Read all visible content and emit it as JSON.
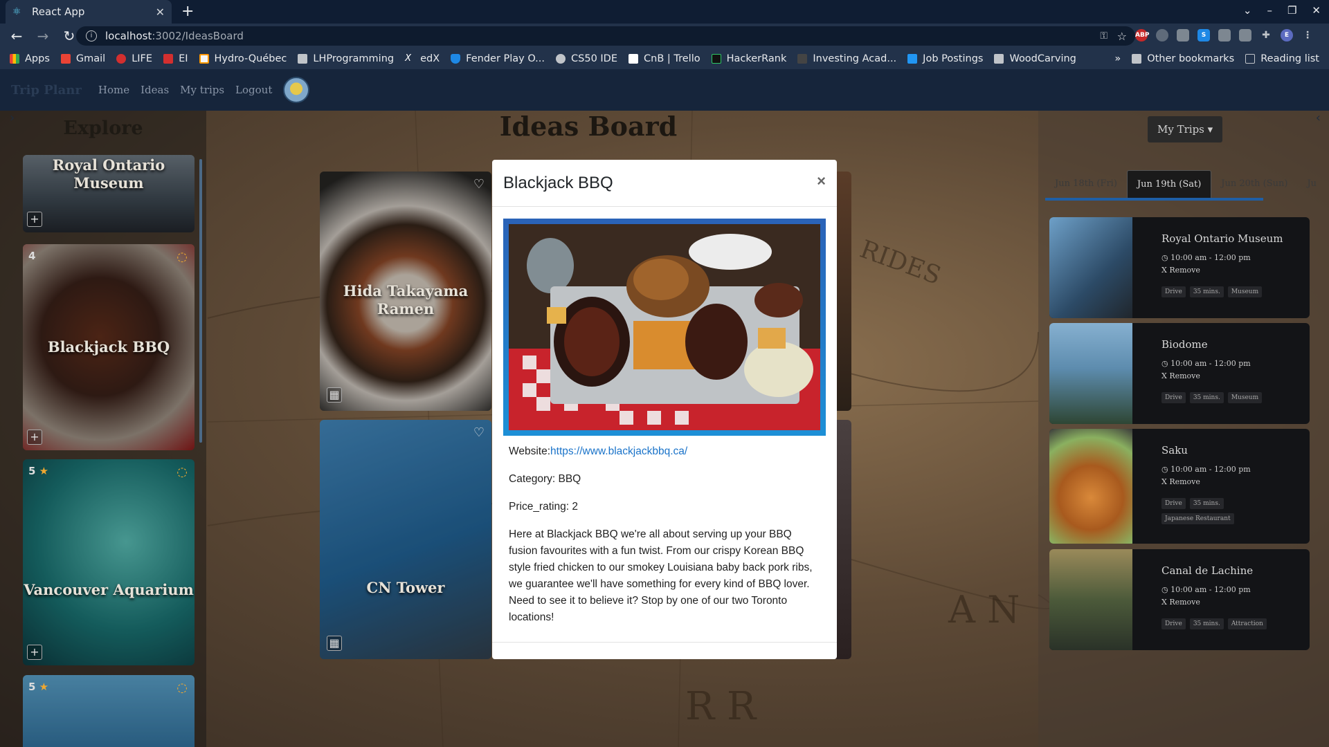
{
  "browser": {
    "tab_title": "React App",
    "url_host": "localhost",
    "url_rest": ":3002/IdeasBoard",
    "bookmarks": [
      "Apps",
      "Gmail",
      "LIFE",
      "EI",
      "Hydro-Québec",
      "LHProgramming",
      "edX",
      "Fender Play O...",
      "CS50 IDE",
      "CnB | Trello",
      "HackerRank",
      "Investing Acad...",
      "Job Postings",
      "WoodCarving"
    ],
    "bookmarks_right": [
      "Other bookmarks",
      "Reading list"
    ],
    "more": "»"
  },
  "navbar": {
    "brand": "Trip Planr",
    "links": [
      "Home",
      "Ideas",
      "My trips",
      "Logout"
    ]
  },
  "explore": {
    "title": "Explore",
    "cards": [
      {
        "title": "Royal Ontario Museum"
      },
      {
        "title": "Blackjack BBQ",
        "rating": "4"
      },
      {
        "title": "Vancouver Aquarium",
        "rating": "5"
      },
      {
        "title": "",
        "rating": "5"
      }
    ]
  },
  "board": {
    "title": "Ideas Board",
    "cards": [
      {
        "title": "Hida Takayama Ramen"
      },
      {
        "title": "CN Tower"
      }
    ]
  },
  "trips": {
    "button": "My Trips",
    "days": [
      "Jun 18th (Fri)",
      "Jun 19th (Sat)",
      "Jun 20th (Sun)",
      "Ju"
    ],
    "items": [
      {
        "name": "Royal Ontario Museum",
        "time": "10:00 am - 12:00 pm",
        "remove": "X Remove",
        "tags": [
          "Drive",
          "35 mins.",
          "Museum"
        ]
      },
      {
        "name": "Biodome",
        "time": "10:00 am - 12:00 pm",
        "remove": "X Remove",
        "tags": [
          "Drive",
          "35 mins.",
          "Museum"
        ]
      },
      {
        "name": "Saku",
        "time": "10:00 am - 12:00 pm",
        "remove": "X Remove",
        "tags": [
          "Drive",
          "35 mins.",
          "Japanese Restaurant"
        ]
      },
      {
        "name": "Canal de Lachine",
        "time": "10:00 am - 12:00 pm",
        "remove": "X Remove",
        "tags": [
          "Drive",
          "35 mins.",
          "Attraction"
        ]
      }
    ]
  },
  "modal": {
    "title": "Blackjack BBQ",
    "close": "×",
    "website_label": "Website:",
    "website_url": "https://www.blackjackbbq.ca/",
    "category": "Category: BBQ",
    "price_rating": "Price_rating: 2",
    "description": "Here at Blackjack BBQ we're all about serving up your BBQ fusion favourites with a fun twist. From our crispy Korean BBQ style fried chicken to our smokey Louisiana baby back pork ribs, we guarantee we'll have something for every kind of BBQ lover. Need to see it to believe it? Stop by one of our two Toronto locations!"
  }
}
